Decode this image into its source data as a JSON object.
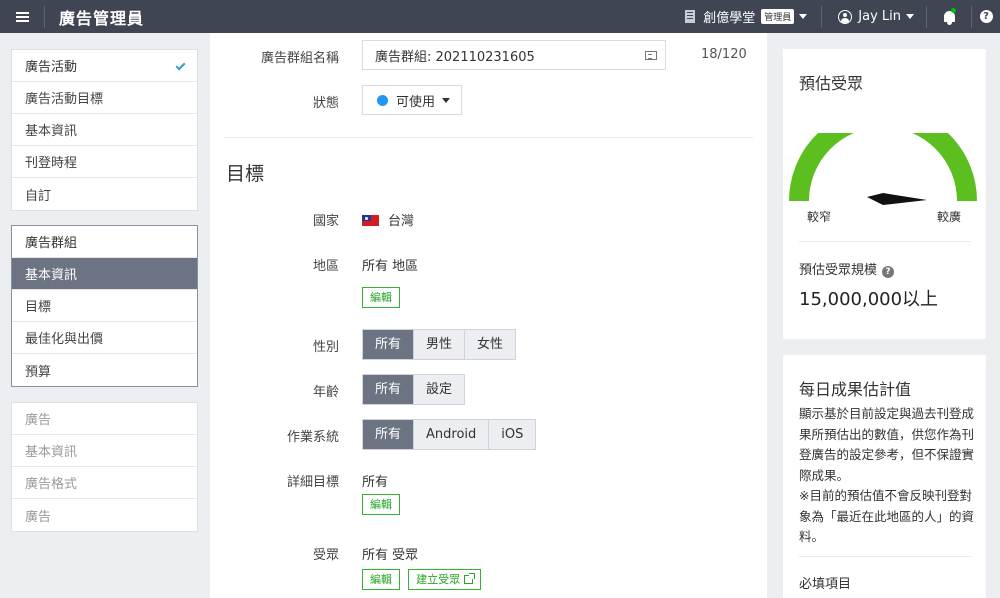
{
  "app": {
    "title": "廣告管理員"
  },
  "header": {
    "account_name": "創億學堂",
    "role_badge": "管理員",
    "user_name": "Jay Lin",
    "help_glyph": "?"
  },
  "sidebar": {
    "groups": [
      {
        "items": [
          "廣告活動",
          "廣告活動目標",
          "基本資訊",
          "刊登時程",
          "自訂"
        ]
      },
      {
        "items": [
          "廣告群組",
          "基本資訊",
          "目標",
          "最佳化與出價",
          "預算"
        ]
      },
      {
        "items": [
          "廣告",
          "基本資訊",
          "廣告格式",
          "廣告"
        ]
      }
    ]
  },
  "form": {
    "name_label": "廣告群組名稱",
    "name_value": "廣告群組: 202110231605",
    "name_counter": "18/120",
    "status_label": "狀態",
    "status_value": "可使用",
    "section_title": "目標",
    "country_label": "國家",
    "country_value": "台灣",
    "region_label": "地區",
    "region_value": "所有 地區",
    "edit_label": "編輯",
    "gender_label": "性別",
    "gender_options": [
      "所有",
      "男性",
      "女性"
    ],
    "age_label": "年齡",
    "age_options": [
      "所有",
      "設定"
    ],
    "os_label": "作業系統",
    "os_options": [
      "所有",
      "Android",
      "iOS"
    ],
    "detail_label": "詳細目標",
    "detail_value": "所有",
    "audience_label": "受眾",
    "audience_value": "所有 受眾",
    "create_audience_label": "建立受眾"
  },
  "audience_card": {
    "title": "預估受眾",
    "narrow_label": "較窄",
    "broad_label": "較廣",
    "gauge_color": "#5dbf1f",
    "size_label": "預估受眾規模",
    "size_value": "15,000,000以上"
  },
  "daily_card": {
    "title": "每日成果估計值",
    "description_1": "顯示基於目前設定與過去刊登成果所預估出的數值，供您作為刊登廣告的設定參考，但不保證實際成果。",
    "description_2": "※目前的預估值不會反映刊登對象為「最近在此地區的人」的資料。",
    "required_label": "必填項目"
  },
  "colors": {
    "topbar": "#3f4552",
    "active_nav": "#6c7484",
    "accent_green": "#28a428",
    "check_blue": "#2a9cd8"
  }
}
